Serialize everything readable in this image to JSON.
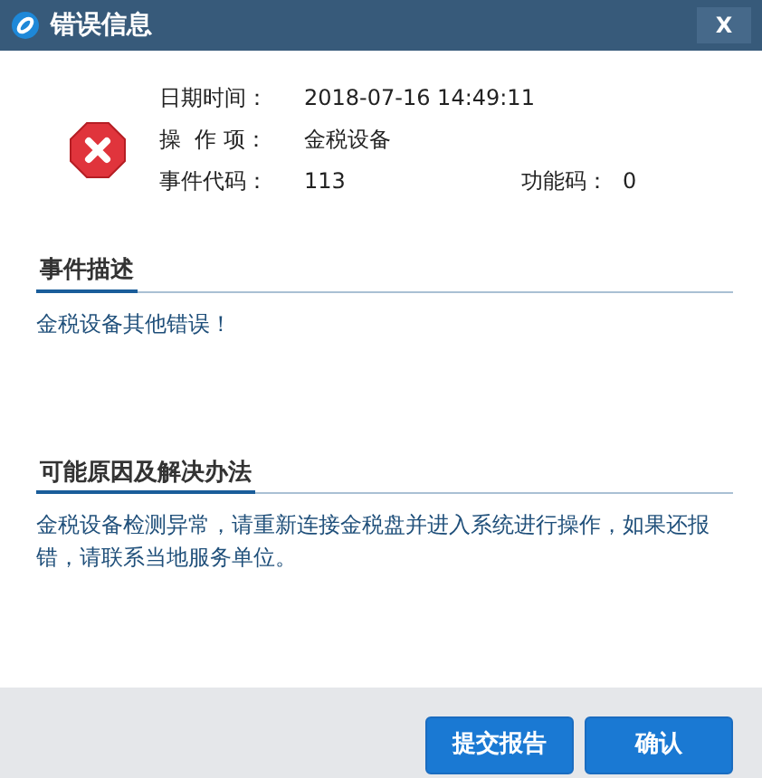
{
  "window": {
    "title": "错误信息",
    "close": "X"
  },
  "info": [
    {
      "label": "日期时间：",
      "value": "2018-07-16 14:49:11"
    },
    {
      "label": "操  作 项：",
      "value": "金税设备"
    },
    {
      "label": "事件代码：",
      "value": "113",
      "extra_label": "功能码：",
      "extra_value": "0"
    }
  ],
  "sections": [
    {
      "heading": "事件描述",
      "text": "金税设备其他错误！"
    },
    {
      "heading": "可能原因及解决办法",
      "text": "金税设备检测异常，请重新连接金税盘并进入系统进行操作，如果还报错，请联系当地服务单位。"
    }
  ],
  "buttons": [
    "提交报告",
    "确认"
  ]
}
